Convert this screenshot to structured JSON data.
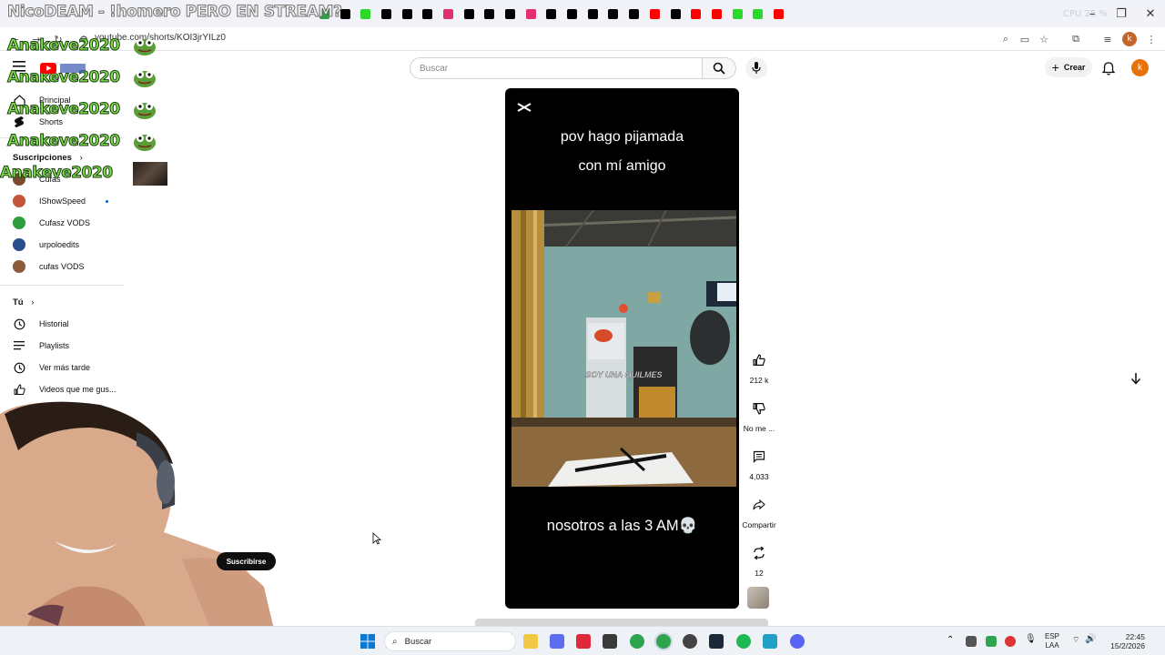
{
  "browser": {
    "url": "youtube.com/shorts/KOI3jrYILz0",
    "cpu_text": "CPU 25 %",
    "tab_icon_colors": [
      "#2f9e44",
      "#000000",
      "#2bd92b",
      "#000000",
      "#000000",
      "#000000",
      "#e1306c",
      "#000000",
      "#000000",
      "#000000",
      "#e1306c",
      "#000000",
      "#000000",
      "#000000",
      "#000000",
      "#000000",
      "#ff0000",
      "#000000",
      "#ff0000",
      "#ff0000",
      "#2bd92b",
      "#2bd92b",
      "#ff0000"
    ]
  },
  "stream_title": "NicoDEAM - !homero PERO EN STREAM?",
  "chat": {
    "username": "Anakeve2020",
    "lines": 5
  },
  "header": {
    "search_placeholder": "Buscar",
    "create_label": "Crear",
    "avatar_letter": "k"
  },
  "sidebar": {
    "home_label": "Principal",
    "shorts_label": "Shorts",
    "subscriptions_heading": "Suscripciones",
    "subscriptions": [
      {
        "label": "Cufas",
        "color": "#7a4b2a"
      },
      {
        "label": "IShowSpeed",
        "color": "#c5553a"
      },
      {
        "label": "Cufasz VODS",
        "color": "#2e9e3a"
      },
      {
        "label": "urpoloedits",
        "color": "#2a4d8f"
      },
      {
        "label": "cufas VODS",
        "color": "#8a5a3a"
      }
    ],
    "you_heading": "Tú",
    "you_items": [
      {
        "label": "Historial",
        "icon": "history-icon"
      },
      {
        "label": "Playlists",
        "icon": "playlists-icon"
      },
      {
        "label": "Ver más tarde",
        "icon": "watch-later-icon"
      },
      {
        "label": "Videos que me gus...",
        "icon": "liked-icon"
      }
    ]
  },
  "short": {
    "top_line1": "pov hago pijamada",
    "top_line2": "con mí amigo",
    "caption": "SOY UNA QUILMES",
    "bottom_text": "nosotros a las 3 AM💀"
  },
  "actions": {
    "likes": "212 k",
    "dislike_label": "No me ...",
    "comments": "4,033",
    "share_label": "Compartir",
    "remix_count": "12"
  },
  "subscribe_label": "Suscribirse",
  "taskbar": {
    "search_label": "Buscar",
    "lang_line1": "ESP",
    "lang_line2": "LAA",
    "time": "22:45",
    "date": "15/2/2026"
  }
}
